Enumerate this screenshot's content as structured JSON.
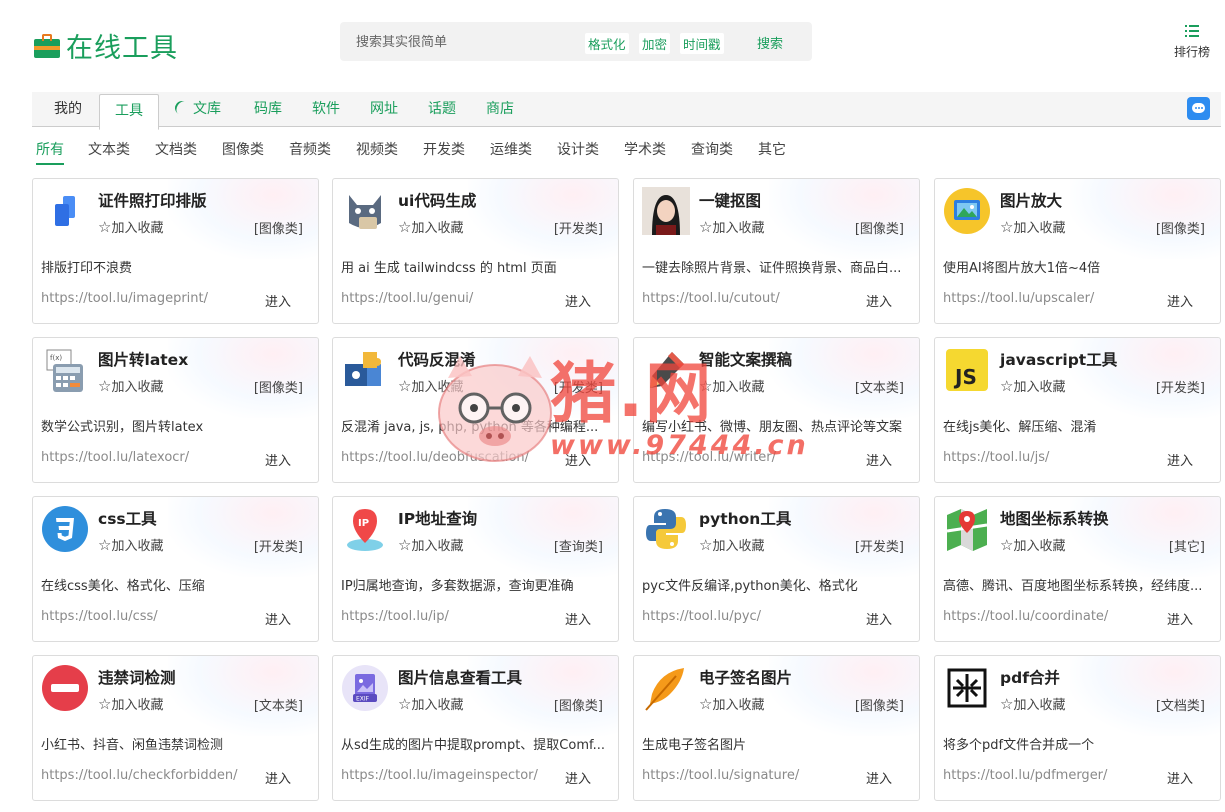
{
  "header": {
    "logo_text": "在线工具",
    "search_placeholder": "搜索其实很简单",
    "search_tags": [
      "格式化",
      "加密",
      "时间戳"
    ],
    "search_button": "搜索",
    "rank_label": "排行榜"
  },
  "nav": {
    "tabs": [
      "我的",
      "工具",
      "文库",
      "码库",
      "软件",
      "网址",
      "话题",
      "商店"
    ],
    "active_tab": "工具"
  },
  "categories": {
    "items": [
      "所有",
      "文本类",
      "文档类",
      "图像类",
      "音频类",
      "视频类",
      "开发类",
      "运维类",
      "设计类",
      "学术类",
      "查询类",
      "其它"
    ],
    "active": "所有"
  },
  "common": {
    "favorite": "加入收藏",
    "enter": "进入"
  },
  "cards": [
    {
      "title": "证件照打印排版",
      "kind": "[图像类]",
      "desc": "排版打印不浪费",
      "url": "https://tool.lu/imageprint/",
      "icon": "id-photo-icon"
    },
    {
      "title": "ui代码生成",
      "kind": "[开发类]",
      "desc": "用 ai 生成 tailwindcss 的 html 页面",
      "url": "https://tool.lu/genui/",
      "icon": "cat-robot-icon"
    },
    {
      "title": "一键抠图",
      "kind": "[图像类]",
      "desc": "一键去除照片背景、证件照换背景、商品白...",
      "url": "https://tool.lu/cutout/",
      "icon": "portrait-icon"
    },
    {
      "title": "图片放大",
      "kind": "[图像类]",
      "desc": "使用AI将图片放大1倍~4倍",
      "url": "https://tool.lu/upscaler/",
      "icon": "image-upscale-icon"
    },
    {
      "title": "图片转latex",
      "kind": "[图像类]",
      "desc": "数学公式识别，图片转latex",
      "url": "https://tool.lu/latexocr/",
      "icon": "calculator-icon"
    },
    {
      "title": "代码反混淆",
      "kind": "[开发类]",
      "desc": "反混淆 java, js, php, python 等各种编程...",
      "url": "https://tool.lu/deobfuscation/",
      "icon": "puzzle-icon"
    },
    {
      "title": "智能文案撰稿",
      "kind": "[文本类]",
      "desc": "编写小红书、微博、朋友圈、热点评论等文案",
      "url": "https://tool.lu/writer/",
      "icon": "pen-icon"
    },
    {
      "title": "javascript工具",
      "kind": "[开发类]",
      "desc": "在线js美化、解压缩、混淆",
      "url": "https://tool.lu/js/",
      "icon": "js-icon"
    },
    {
      "title": "css工具",
      "kind": "[开发类]",
      "desc": "在线css美化、格式化、压缩",
      "url": "https://tool.lu/css/",
      "icon": "css3-icon"
    },
    {
      "title": "IP地址查询",
      "kind": "[查询类]",
      "desc": "IP归属地查询，多套数据源，查询更准确",
      "url": "https://tool.lu/ip/",
      "icon": "ip-pin-icon"
    },
    {
      "title": "python工具",
      "kind": "[开发类]",
      "desc": "pyc文件反编译,python美化、格式化",
      "url": "https://tool.lu/pyc/",
      "icon": "python-icon"
    },
    {
      "title": "地图坐标系转换",
      "kind": "[其它]",
      "desc": "高德、腾讯、百度地图坐标系转换，经纬度...",
      "url": "https://tool.lu/coordinate/",
      "icon": "map-icon"
    },
    {
      "title": "违禁词检测",
      "kind": "[文本类]",
      "desc": "小红书、抖音、闲鱼违禁词检测",
      "url": "https://tool.lu/checkforbidden/",
      "icon": "no-entry-icon"
    },
    {
      "title": "图片信息查看工具",
      "kind": "[图像类]",
      "desc": "从sd生成的图片中提取prompt、提取Comf...",
      "url": "https://tool.lu/imageinspector/",
      "icon": "exif-icon"
    },
    {
      "title": "电子签名图片",
      "kind": "[图像类]",
      "desc": "生成电子签名图片",
      "url": "https://tool.lu/signature/",
      "icon": "feather-icon"
    },
    {
      "title": "pdf合并",
      "kind": "[文档类]",
      "desc": "将多个pdf文件合并成一个",
      "url": "https://tool.lu/pdfmerger/",
      "icon": "merge-icon"
    }
  ],
  "watermark": {
    "text": "猪.网",
    "url": "www.97444.cn"
  }
}
